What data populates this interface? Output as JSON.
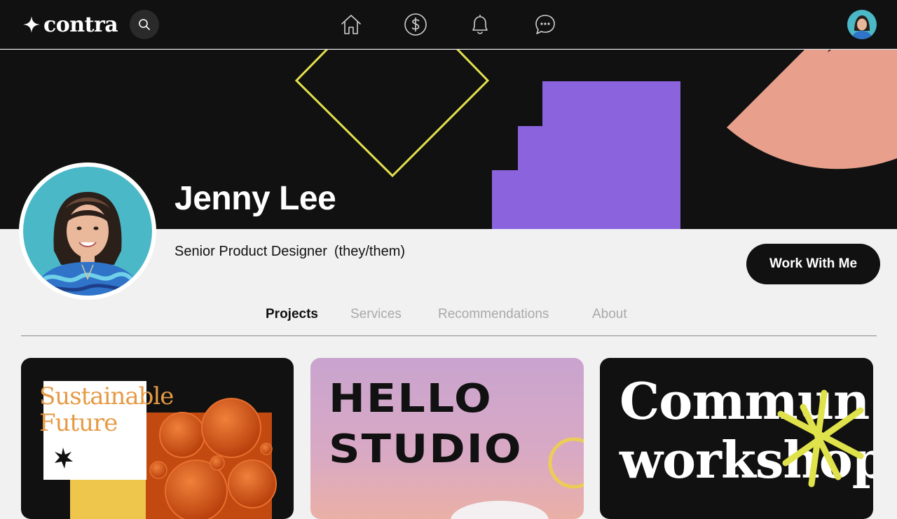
{
  "app": {
    "brand": "contra"
  },
  "profile": {
    "name": "Jenny Lee",
    "title": "Senior Product Designer",
    "pronouns": "(they/them)",
    "cta_label": "Work With Me"
  },
  "tabs": [
    {
      "label": "Projects",
      "active": true
    },
    {
      "label": "Services",
      "active": false
    },
    {
      "label": "Recommendations",
      "active": false
    },
    {
      "label": "About",
      "active": false
    }
  ],
  "projects": [
    {
      "line1": "Sustainable",
      "line2": "Future"
    },
    {
      "line1": "HELLO",
      "line2": "STUDIO"
    },
    {
      "line1": "Commun",
      "line2": "workshop"
    }
  ],
  "colors": {
    "background": "#f1f1f1",
    "topbar": "#111111",
    "accent_yellow": "#e5e04e",
    "accent_purple": "#8b63dd",
    "accent_peach": "#e8a08c",
    "accent_orange": "#e69a45"
  },
  "icons": [
    "search-icon",
    "home-icon",
    "dollar-icon",
    "bell-icon",
    "chat-icon"
  ]
}
